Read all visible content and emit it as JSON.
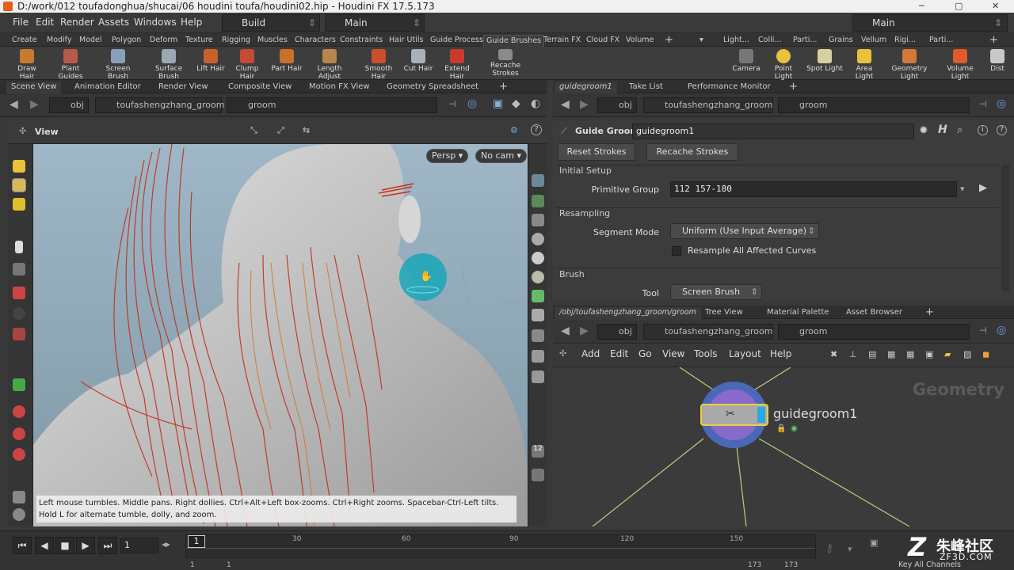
{
  "title": "D:/work/012 toufadonghua/shucai/06 houdini toufa/houdini02.hip - Houdini FX 17.5.173",
  "menu": [
    "File",
    "Edit",
    "Render",
    "Assets",
    "Windows",
    "Help"
  ],
  "desktop_build": "Build",
  "desktop_main": "Main",
  "desktop_main_right": "Main",
  "shelf_tabs": [
    "Create",
    "Modify",
    "Model",
    "Polygon",
    "Deform",
    "Texture",
    "Rigging",
    "Muscles",
    "Characters",
    "Constraints",
    "Hair Utils",
    "Guide Process",
    "Guide Brushes",
    "Terrain FX",
    "Cloud FX",
    "Volume"
  ],
  "shelf_tabs_right": [
    "Light...",
    "Colli...",
    "Parti...",
    "Grains",
    "Vellum",
    "Rigi...",
    "Parti..."
  ],
  "shelf_tools": [
    "Draw Hair",
    "Plant Guides",
    "Screen Brush",
    "Surface Brush",
    "Lift Hair",
    "Clump Hair",
    "Part Hair",
    "Length Adjust",
    "Smooth Hair",
    "Cut Hair",
    "Extend Hair",
    "Recache Strokes"
  ],
  "shelf_tools_right": [
    "Camera",
    "Point Light",
    "Spot Light",
    "Area Light",
    "Geometry Light",
    "Volume Light",
    "Dist"
  ],
  "left_tabs": [
    "Scene View",
    "Animation Editor",
    "Render View",
    "Composite View",
    "Motion FX View",
    "Geometry Spreadsheet"
  ],
  "path": {
    "obj": "obj",
    "object": "toufashengzhang_groom",
    "node": "groom"
  },
  "view": {
    "title": "View",
    "persp": "Persp",
    "cam": "No cam"
  },
  "hint": "Left mouse tumbles. Middle pans. Right dollies. Ctrl+Alt+Left box-zooms. Ctrl+Right zooms. Spacebar-Ctrl-Left tilts. Hold L for alternate tumble, dolly, and zoom.",
  "right_tabs": [
    "guidegroom1",
    "Take List",
    "Performance Monitor"
  ],
  "params": {
    "node_type": "Guide Groom",
    "node_name": "guidegroom1",
    "reset_btn": "Reset Strokes",
    "recache_btn": "Recache Strokes",
    "initial_setup": "Initial Setup",
    "primitive_group_label": "Primitive Group",
    "primitive_group_value": "112 157-180",
    "resampling": "Resampling",
    "segment_mode_label": "Segment Mode",
    "segment_mode_value": "Uniform (Use Input Average)",
    "resample_all": "Resample All Affected Curves",
    "brush": "Brush",
    "tool_label": "Tool",
    "tool_value": "Screen Brush"
  },
  "net_tabs": [
    "/obj/toufashengzhang_groom/groom",
    "Tree View",
    "Material Palette",
    "Asset Browser"
  ],
  "net_menu": [
    "Add",
    "Edit",
    "Go",
    "View",
    "Tools",
    "Layout",
    "Help"
  ],
  "network": {
    "context": "Geometry",
    "node_label": "guidegroom1"
  },
  "timeline": {
    "frame": "1",
    "ticks": [
      "1",
      "30",
      "60",
      "90",
      "120",
      "150"
    ],
    "end1": "173",
    "end2": "173",
    "start1": "1",
    "start2": "1"
  },
  "key_all": "Key All Channels",
  "watermark": {
    "brand": "朱峰社区",
    "url": "ZF3D.COM"
  },
  "colors": {
    "accent": "#e0b84a",
    "brush": "#1aa6b8",
    "hair": "#c42f1c"
  }
}
